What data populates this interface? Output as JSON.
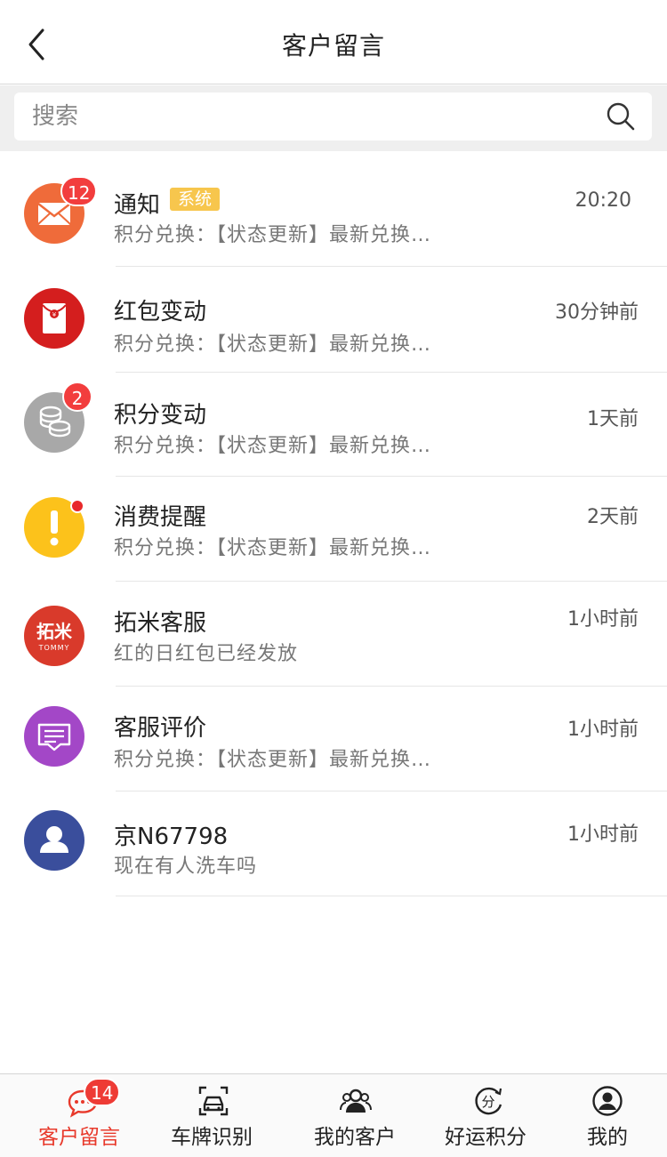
{
  "header": {
    "title": "客户留言",
    "back_icon": "chevron-left-icon"
  },
  "search": {
    "placeholder": "搜索",
    "value": "",
    "icon": "search-icon"
  },
  "colors": {
    "accent": "#e8392b",
    "badge": "#f23d3d",
    "tag": "#f7c64d"
  },
  "messages": [
    {
      "title": "通知",
      "tag": "系统",
      "time": "20:20",
      "preview": "积分兑换：【状态更新】最新兑换…",
      "badge": "12",
      "icon": "mail-icon",
      "color": "#ef6b3a"
    },
    {
      "title": "红包变动",
      "time": "30分钟前",
      "preview": "积分兑换：【状态更新】最新兑换…",
      "icon": "red-envelope-icon",
      "color": "#d41e1e"
    },
    {
      "title": "积分变动",
      "time": "1天前",
      "preview": "积分兑换：【状态更新】最新兑换…",
      "badge": "2",
      "icon": "coins-icon",
      "color": "#a8a8a8"
    },
    {
      "title": "消费提醒",
      "time": "2天前",
      "preview": "积分兑换：【状态更新】最新兑换…",
      "unread_dot": true,
      "icon": "alert-icon",
      "color": "#fcc21b"
    },
    {
      "title": "拓米客服",
      "time": "1小时前",
      "preview": "红的日红包已经发放",
      "icon": "tommy-logo-icon",
      "color": "#d93a2b",
      "logo_text": "拓米",
      "logo_sub": "TOMMY"
    },
    {
      "title": "客服评价",
      "time": "1小时前",
      "preview": "积分兑换：【状态更新】最新兑换…",
      "icon": "chat-list-icon",
      "color": "#a347c7"
    },
    {
      "title": "京N67798",
      "time": "1小时前",
      "preview": "现在有人洗车吗",
      "icon": "user-icon",
      "color": "#3a4e9c"
    }
  ],
  "tabbar": {
    "tabs": [
      {
        "label": "客户留言",
        "icon": "chat-bubble-icon",
        "badge": "14",
        "active": true
      },
      {
        "label": "车牌识别",
        "icon": "car-scan-icon"
      },
      {
        "label": "我的客户",
        "icon": "people-icon"
      },
      {
        "label": "好运积分",
        "icon": "points-icon",
        "icon_text": "分"
      },
      {
        "label": "我的",
        "icon": "profile-icon"
      }
    ]
  }
}
